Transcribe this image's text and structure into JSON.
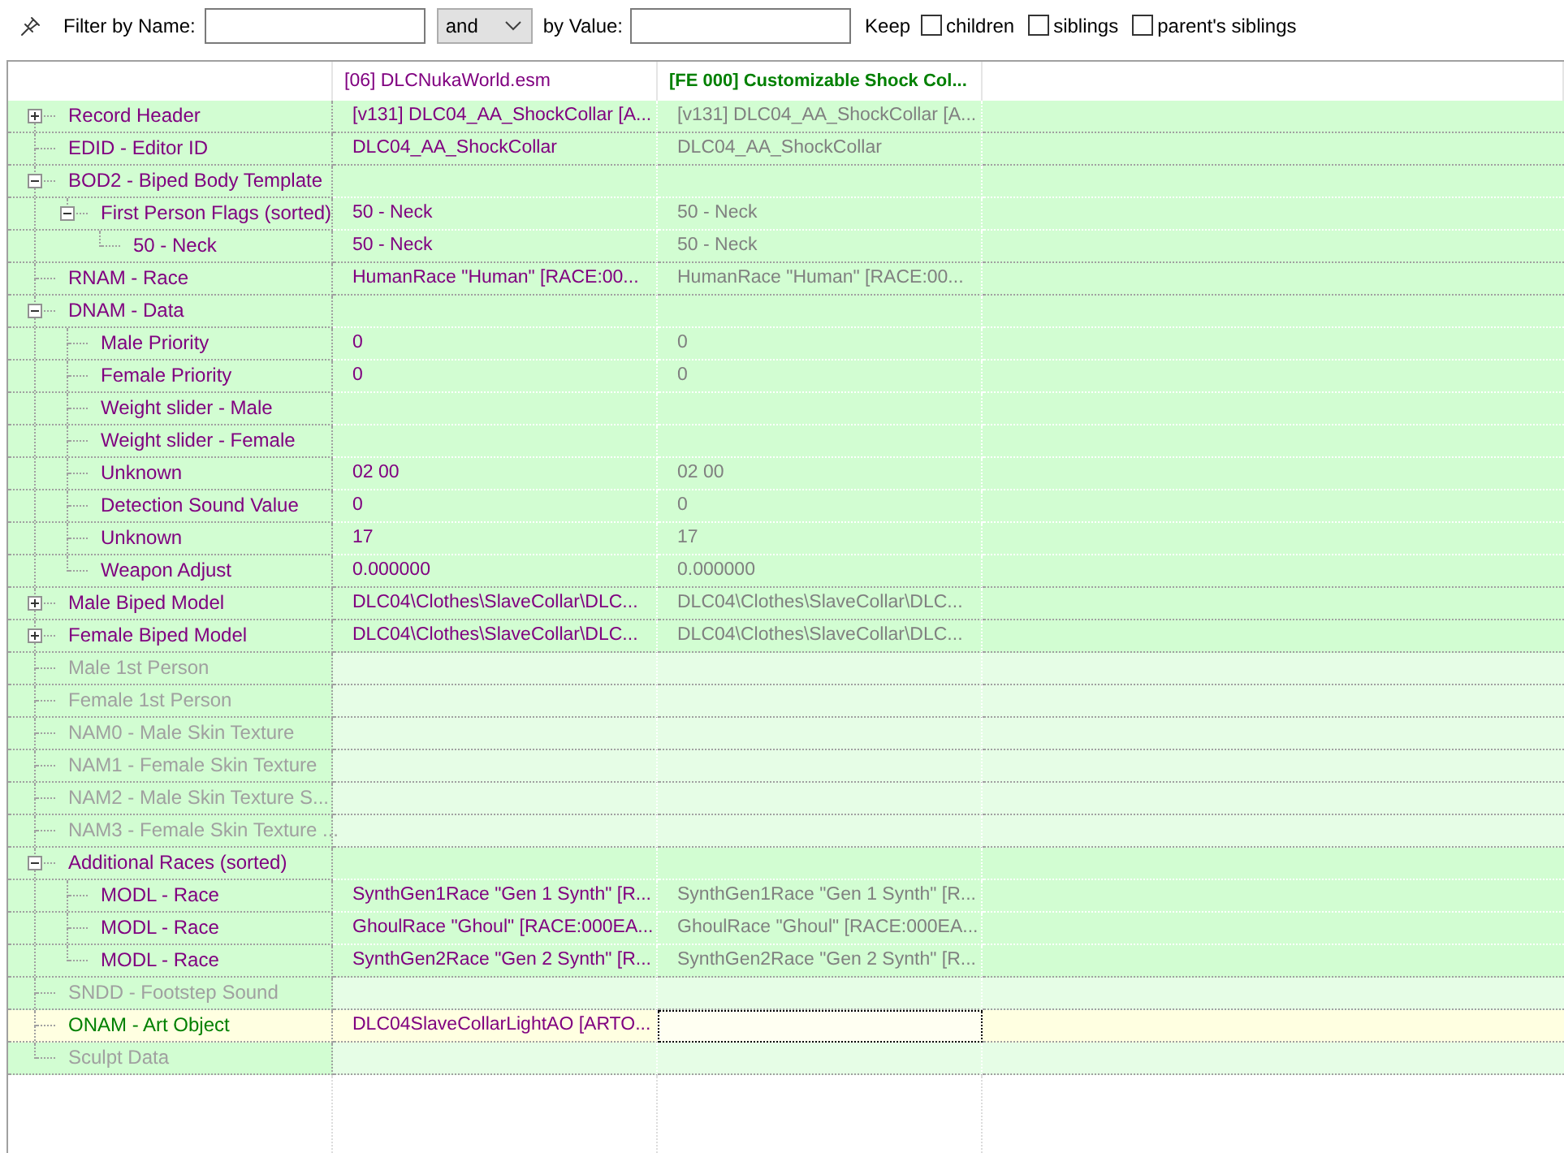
{
  "filter": {
    "name_label": "Filter by Name:",
    "operator": "and",
    "value_label": "by Value:",
    "keep_label": "Keep",
    "keep_options": [
      {
        "label": "children",
        "checked": false
      },
      {
        "label": "siblings",
        "checked": false
      },
      {
        "label": "parent's siblings",
        "checked": false
      }
    ]
  },
  "grid": {
    "columns": [
      {
        "label": "[06] DLCNukaWorld.esm",
        "color": "#800080"
      },
      {
        "label": "[FE 000] Customizable Shock Col...",
        "color": "#008000"
      }
    ],
    "rows": [
      {
        "name": "Record Header",
        "color": "#800080",
        "present": true,
        "selected": false,
        "expanded": false,
        "values": [
          "[v131] DLC04_AA_ShockCollar [A...",
          "[v131] DLC04_AA_ShockCollar [A..."
        ]
      },
      {
        "name": "EDID - Editor ID",
        "color": "#800080",
        "present": true,
        "selected": false,
        "values": [
          "DLC04_AA_ShockCollar",
          "DLC04_AA_ShockCollar"
        ]
      },
      {
        "name": "BOD2 - Biped Body Template",
        "color": "#800080",
        "present": true,
        "selected": false,
        "expanded": true,
        "children": [
          {
            "name": "First Person Flags (sorted)",
            "color": "#800080",
            "present": true,
            "selected": false,
            "expanded": true,
            "values": [
              "50 - Neck",
              "50 - Neck"
            ],
            "children": [
              {
                "name": "50 - Neck",
                "color": "#800080",
                "present": true,
                "selected": false,
                "values": [
                  "50 - Neck",
                  "50 - Neck"
                ]
              }
            ]
          }
        ]
      },
      {
        "name": "RNAM - Race",
        "color": "#800080",
        "present": true,
        "selected": false,
        "values": [
          "HumanRace \"Human\" [RACE:00...",
          "HumanRace \"Human\" [RACE:00..."
        ]
      },
      {
        "name": "DNAM - Data",
        "color": "#800080",
        "present": true,
        "selected": false,
        "expanded": true,
        "children": [
          {
            "name": "Male Priority",
            "color": "#800080",
            "present": true,
            "selected": false,
            "values": [
              "0",
              "0"
            ]
          },
          {
            "name": "Female Priority",
            "color": "#800080",
            "present": true,
            "selected": false,
            "values": [
              "0",
              "0"
            ]
          },
          {
            "name": "Weight slider - Male",
            "color": "#800080",
            "present": true,
            "selected": false
          },
          {
            "name": "Weight slider - Female",
            "color": "#800080",
            "present": true,
            "selected": false
          },
          {
            "name": "Unknown",
            "color": "#800080",
            "present": true,
            "selected": false,
            "values": [
              "02 00",
              "02 00"
            ]
          },
          {
            "name": "Detection Sound Value",
            "color": "#800080",
            "present": true,
            "selected": false,
            "values": [
              "0",
              "0"
            ]
          },
          {
            "name": "Unknown",
            "color": "#800080",
            "present": true,
            "selected": false,
            "values": [
              "17",
              "17"
            ]
          },
          {
            "name": "Weapon Adjust",
            "color": "#800080",
            "present": true,
            "selected": false,
            "values": [
              "0.000000",
              "0.000000"
            ]
          }
        ]
      },
      {
        "name": "Male Biped Model",
        "color": "#800080",
        "present": true,
        "selected": false,
        "expanded": false,
        "values": [
          "DLC04\\Clothes\\SlaveCollar\\DLC...",
          "DLC04\\Clothes\\SlaveCollar\\DLC..."
        ]
      },
      {
        "name": "Female Biped Model",
        "color": "#800080",
        "present": true,
        "selected": false,
        "expanded": false,
        "values": [
          "DLC04\\Clothes\\SlaveCollar\\DLC...",
          "DLC04\\Clothes\\SlaveCollar\\DLC..."
        ]
      },
      {
        "name": "Male 1st Person",
        "color": "#a0a0a0",
        "present": false,
        "selected": false
      },
      {
        "name": "Female 1st Person",
        "color": "#a0a0a0",
        "present": false,
        "selected": false
      },
      {
        "name": "NAM0 - Male Skin Texture",
        "color": "#a0a0a0",
        "present": false,
        "selected": false
      },
      {
        "name": "NAM1 - Female Skin Texture",
        "color": "#a0a0a0",
        "present": false,
        "selected": false
      },
      {
        "name": "NAM2 - Male Skin Texture S...",
        "color": "#a0a0a0",
        "present": false,
        "selected": false
      },
      {
        "name": "NAM3 - Female Skin Texture ...",
        "color": "#a0a0a0",
        "present": false,
        "selected": false
      },
      {
        "name": "Additional Races (sorted)",
        "color": "#800080",
        "present": true,
        "selected": false,
        "expanded": true,
        "children": [
          {
            "name": "MODL - Race",
            "color": "#800080",
            "present": true,
            "selected": false,
            "values": [
              "SynthGen1Race \"Gen 1 Synth\" [R...",
              "SynthGen1Race \"Gen 1 Synth\" [R..."
            ]
          },
          {
            "name": "MODL - Race",
            "color": "#800080",
            "present": true,
            "selected": false,
            "values": [
              "GhoulRace \"Ghoul\" [RACE:000EA...",
              "GhoulRace \"Ghoul\" [RACE:000EA..."
            ]
          },
          {
            "name": "MODL - Race",
            "color": "#800080",
            "present": true,
            "selected": false,
            "values": [
              "SynthGen2Race \"Gen 2 Synth\" [R...",
              "SynthGen2Race \"Gen 2 Synth\" [R..."
            ]
          }
        ]
      },
      {
        "name": "SNDD - Footstep Sound",
        "color": "#a0a0a0",
        "present": false,
        "selected": false
      },
      {
        "name": "ONAM - Art Object",
        "color": "#008000",
        "present": true,
        "selected": true,
        "values": [
          "DLC04SlaveCollarLightAO [ARTO..."
        ]
      },
      {
        "name": "Sculpt Data",
        "color": "#a0a0a0",
        "present": false,
        "selected": false
      }
    ]
  }
}
